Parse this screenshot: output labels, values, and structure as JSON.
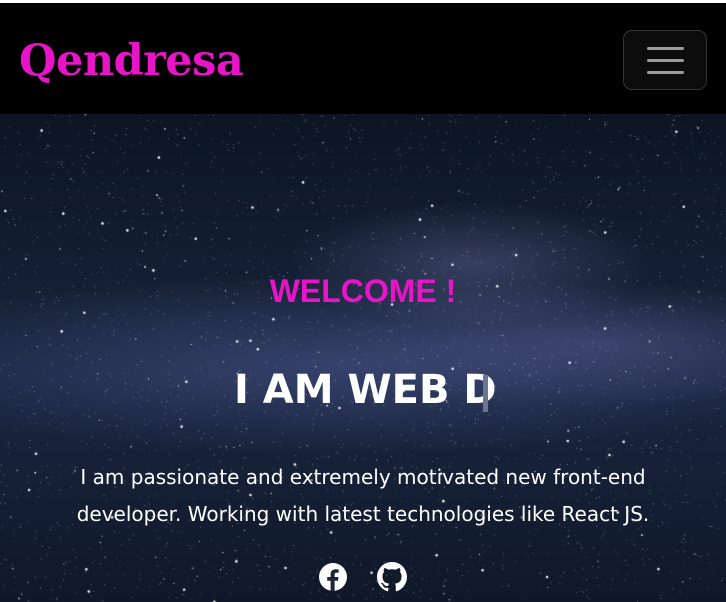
{
  "navbar": {
    "brand": "Qendresa",
    "toggler_icon": "hamburger-menu-icon"
  },
  "hero": {
    "welcome": "WELCOME !",
    "typed_text": "I AM WEB D",
    "description": "I am passionate and extremely motivated new front-end developer. Working with latest technologies like React JS.",
    "social": [
      {
        "icon": "facebook-icon"
      },
      {
        "icon": "github-icon"
      }
    ]
  },
  "colors": {
    "brand": "#e714c8",
    "accent": "#e714c8",
    "navbar_bg": "#000000",
    "text": "#ffffff"
  }
}
